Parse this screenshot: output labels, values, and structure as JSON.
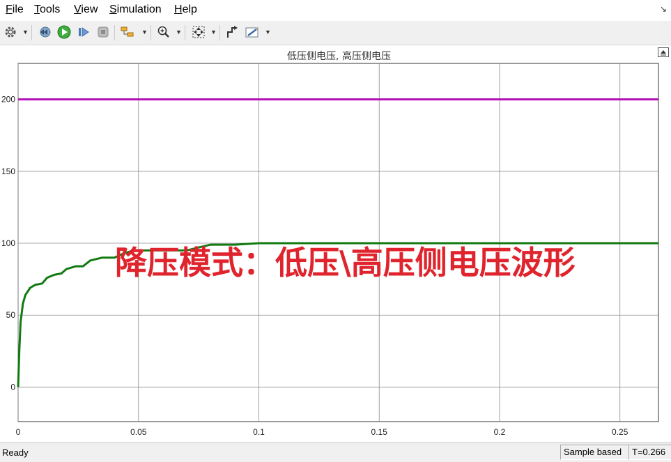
{
  "menu": [
    "File",
    "Tools",
    "View",
    "Simulation",
    "Help"
  ],
  "toolbar": {
    "icons": [
      "gear-icon",
      "step-back-icon",
      "run-icon",
      "step-forward-icon",
      "stop-icon",
      "highlight-icon",
      "zoom-icon",
      "fit-to-view-icon",
      "cursor-measure-icon",
      "style-icon"
    ]
  },
  "plot": {
    "title": "低压侧电压, 高压侧电压",
    "overlay": "降压模式：低压\\高压侧电压波形"
  },
  "status": {
    "text": "Ready",
    "mode": "Sample based",
    "time": "T=0.266"
  },
  "colors": {
    "high_side": "#b40fb4",
    "low_side": "#117a11",
    "overlay": "#e0242d"
  },
  "chart_data": {
    "type": "line",
    "title": "低压侧电压, 高压侧电压",
    "xlim": [
      0,
      0.266
    ],
    "ylim": [
      -24,
      225
    ],
    "xticks": [
      0,
      0.05,
      0.1,
      0.15,
      0.2,
      0.25
    ],
    "xtick_labels": [
      "0",
      "0.05",
      "0.1",
      "0.15",
      "0.2",
      "0.25"
    ],
    "yticks": [
      0,
      50,
      100,
      150,
      200
    ],
    "ytick_labels": [
      "0",
      "50",
      "100",
      "150",
      "200"
    ],
    "grid": true,
    "series": [
      {
        "color": "#b40fb4",
        "x": [
          0,
          0.266
        ],
        "y": [
          200,
          200
        ]
      },
      {
        "color": "#117a11",
        "x": [
          0,
          0.0005,
          0.001,
          0.002,
          0.003,
          0.005,
          0.007,
          0.01,
          0.012,
          0.015,
          0.018,
          0.02,
          0.024,
          0.027,
          0.03,
          0.035,
          0.04,
          0.044,
          0.048,
          0.055,
          0.06,
          0.07,
          0.075,
          0.08,
          0.09,
          0.1,
          0.12,
          0.15,
          0.2,
          0.25,
          0.266
        ],
        "y": [
          0,
          25,
          45,
          58,
          64,
          69,
          71,
          72,
          76,
          78,
          79,
          82,
          84,
          84,
          88,
          90,
          90,
          93,
          95,
          95,
          95,
          95,
          97,
          99,
          99,
          100,
          100,
          100,
          100,
          100,
          100
        ]
      }
    ]
  }
}
